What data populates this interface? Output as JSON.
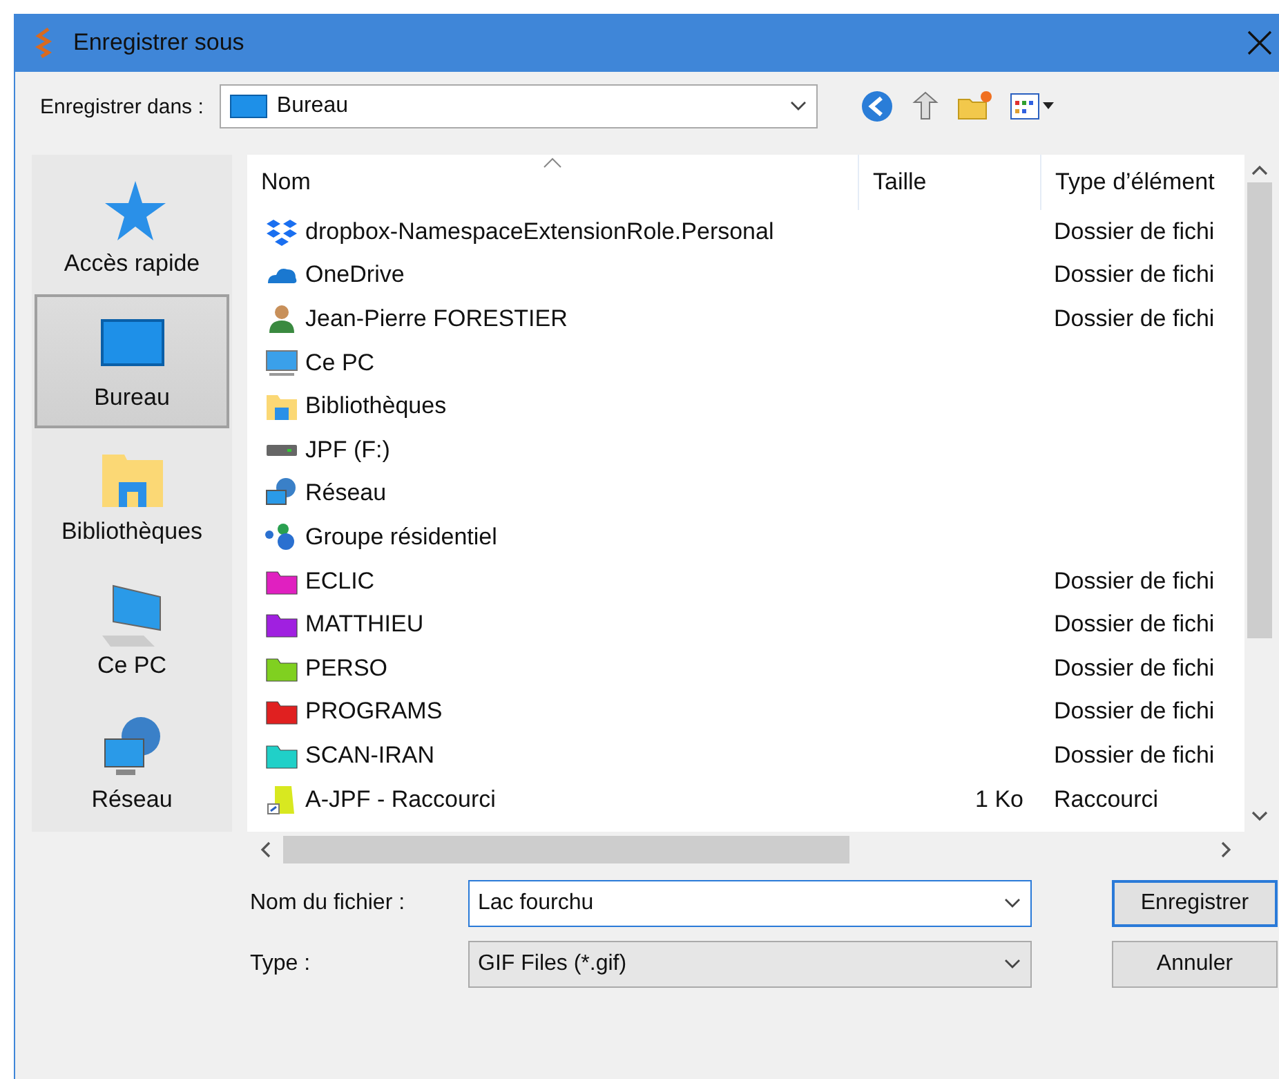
{
  "window": {
    "title": "Enregistrer sous"
  },
  "location": {
    "label": "Enregistrer dans :",
    "value": "Bureau"
  },
  "sidebar": {
    "items": [
      {
        "label": "Accès rapide",
        "kind": "star",
        "selected": false
      },
      {
        "label": "Bureau",
        "kind": "desktop",
        "selected": true
      },
      {
        "label": "Bibliothèques",
        "kind": "library",
        "selected": false
      },
      {
        "label": "Ce PC",
        "kind": "pc",
        "selected": false
      },
      {
        "label": "Réseau",
        "kind": "network",
        "selected": false
      }
    ]
  },
  "table": {
    "columns": [
      "Nom",
      "Taille",
      "Type d’élément"
    ],
    "rows": [
      {
        "name": "dropbox-NamespaceExtensionRole.Personal",
        "size": "",
        "type": "Dossier de fichi",
        "kind": "dropbox"
      },
      {
        "name": "OneDrive",
        "size": "",
        "type": "Dossier de fichi",
        "kind": "cloud"
      },
      {
        "name": "Jean-Pierre FORESTIER",
        "size": "",
        "type": "Dossier de fichi",
        "kind": "user"
      },
      {
        "name": "Ce PC",
        "size": "",
        "type": "",
        "kind": "pc"
      },
      {
        "name": "Bibliothèques",
        "size": "",
        "type": "",
        "kind": "library"
      },
      {
        "name": "JPF (F:)",
        "size": "",
        "type": "",
        "kind": "drive"
      },
      {
        "name": "Réseau",
        "size": "",
        "type": "",
        "kind": "network"
      },
      {
        "name": "Groupe résidentiel",
        "size": "",
        "type": "",
        "kind": "homegroup"
      },
      {
        "name": "ECLIC",
        "size": "",
        "type": "Dossier de fichi",
        "kind": "folder",
        "color": "#e020c0"
      },
      {
        "name": "MATTHIEU",
        "size": "",
        "type": "Dossier de fichi",
        "kind": "folder",
        "color": "#a020e0"
      },
      {
        "name": "PERSO",
        "size": "",
        "type": "Dossier de fichi",
        "kind": "folder",
        "color": "#80d020"
      },
      {
        "name": "PROGRAMS",
        "size": "",
        "type": "Dossier de fichi",
        "kind": "folder",
        "color": "#e02020"
      },
      {
        "name": "SCAN-IRAN",
        "size": "",
        "type": "Dossier de fichi",
        "kind": "folder",
        "color": "#20d0c8"
      },
      {
        "name": "A-JPF - Raccourci",
        "size": "1 Ko",
        "type": "Raccourci",
        "kind": "shortcut"
      }
    ]
  },
  "filename": {
    "label": "Nom du fichier :",
    "value": "Lac fourchu"
  },
  "filetype": {
    "label": "Type :",
    "value": "GIF Files (*.gif)"
  },
  "buttons": [
    {
      "label": "Enregistrer",
      "default": true
    },
    {
      "label": "Annuler",
      "default": false
    }
  ]
}
